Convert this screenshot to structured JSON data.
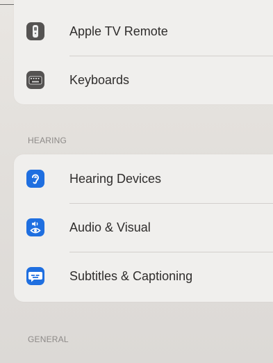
{
  "colors": {
    "background": "#e4e1de",
    "group_background": "#f0efed",
    "section_header": "#8d8a88",
    "row_text": "#2f2d2c",
    "icon_gray": "#555352",
    "icon_blue": "#1f6fe0"
  },
  "groups": [
    {
      "rows": [
        {
          "label": "Apple TV Remote",
          "icon": "remote-icon",
          "icon_color": "#555352"
        },
        {
          "label": "Keyboards",
          "icon": "keyboard-icon",
          "icon_color": "#555352"
        }
      ]
    },
    {
      "header": "HEARING",
      "rows": [
        {
          "label": "Hearing Devices",
          "icon": "ear-icon",
          "icon_color": "#1f6fe0"
        },
        {
          "label": "Audio & Visual",
          "icon": "speaker-eye-icon",
          "icon_color": "#1f6fe0"
        },
        {
          "label": "Subtitles & Captioning",
          "icon": "captions-icon",
          "icon_color": "#1f6fe0"
        }
      ]
    }
  ],
  "next_section": {
    "header": "GENERAL"
  }
}
